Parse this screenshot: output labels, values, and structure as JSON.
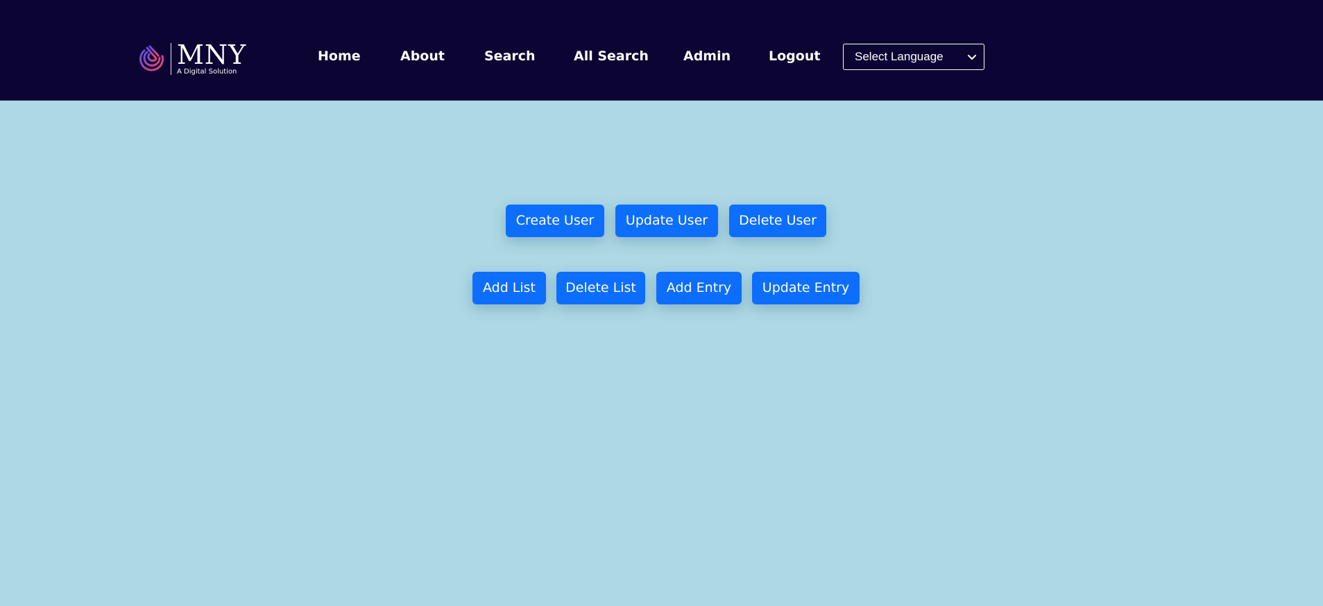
{
  "brand": {
    "name": "MNY",
    "tagline": "A Digital Solution",
    "logo_icon": "fingerprint-arc-icon",
    "colors": {
      "header_bg": "#0c0533",
      "page_bg": "#add8e4",
      "button_bg": "#0d6efd",
      "logo_gradient_start": "#5b4fe8",
      "logo_gradient_end": "#f2436b"
    }
  },
  "nav": {
    "items": [
      {
        "label": "Home"
      },
      {
        "label": "About"
      },
      {
        "label": "Search"
      },
      {
        "label": "All Search"
      },
      {
        "label": "Admin"
      },
      {
        "label": "Logout"
      }
    ],
    "language_select": {
      "selected": "Select Language",
      "icon": "chevron-down-icon"
    }
  },
  "actions": {
    "user_row": [
      {
        "label": "Create User"
      },
      {
        "label": "Update User"
      },
      {
        "label": "Delete User"
      }
    ],
    "list_row": [
      {
        "label": "Add List"
      },
      {
        "label": "Delete List"
      },
      {
        "label": "Add Entry"
      },
      {
        "label": "Update Entry"
      }
    ]
  }
}
